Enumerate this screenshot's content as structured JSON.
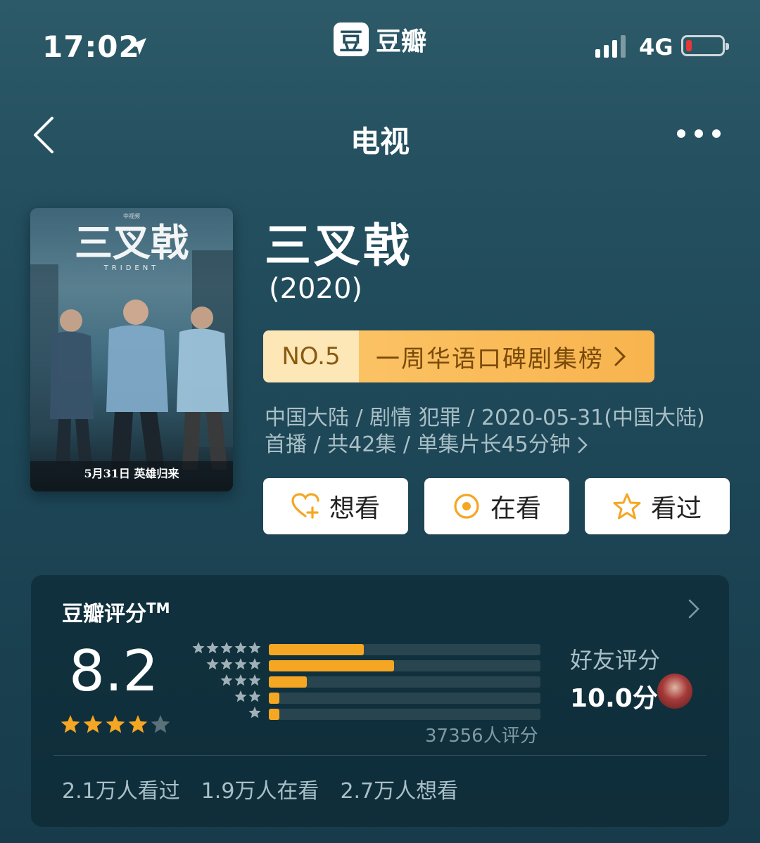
{
  "status_bar": {
    "time": "17:02",
    "app_name": "豆瓣",
    "app_logo_glyph": "豆",
    "network": "4G",
    "battery_color": "#e53935"
  },
  "nav": {
    "title": "电视"
  },
  "poster": {
    "title_text": "三叉戟",
    "subtitle_text": "TRIDENT",
    "tagline": "5月31日  英雄归来"
  },
  "show": {
    "title": "三叉戟",
    "year": "(2020)",
    "rank_no": "NO.5",
    "rank_list": "一周华语口碑剧集榜",
    "meta_line1": "中国大陆 / 剧情 犯罪 / 2020-05-31(中国大陆)",
    "meta_line2": "首播 / 共42集 / 单集片长45分钟"
  },
  "actions": [
    {
      "label": "想看",
      "icon": "heart-plus-icon"
    },
    {
      "label": "在看",
      "icon": "target-circle-icon"
    },
    {
      "label": "看过",
      "icon": "star-outline-icon"
    }
  ],
  "rating": {
    "heading": "豆瓣评分",
    "trademark": "TM",
    "score": "8.2",
    "star_count": 4,
    "distribution": [
      {
        "stars": 5,
        "fraction": 0.35
      },
      {
        "stars": 4,
        "fraction": 0.46
      },
      {
        "stars": 3,
        "fraction": 0.14
      },
      {
        "stars": 2,
        "fraction": 0.04
      },
      {
        "stars": 1,
        "fraction": 0.04
      }
    ],
    "votes": "37356人评分",
    "friend_label": "好友评分",
    "friend_score": "10.0分",
    "stats": [
      "2.1万人看过",
      "1.9万人在看",
      "2.7万人想看"
    ]
  },
  "colors": {
    "accent": "#f5a623",
    "rank_light": "#fde7b7",
    "rank_bar": "#fbc264"
  }
}
